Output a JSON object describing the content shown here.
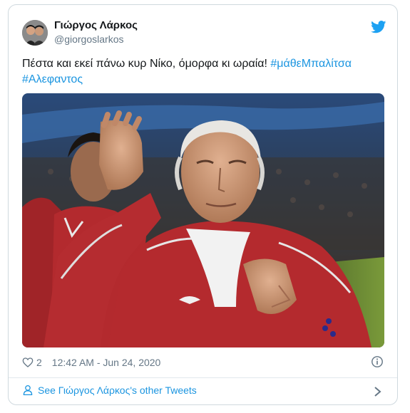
{
  "author": {
    "name": "Γιώργος Λάρκος",
    "handle": "@giorgoslarkos"
  },
  "tweet": {
    "text": "Πέστα και εκεί πάνω κυρ Νίκο, όμορφα κι ωραία! ",
    "hashtags": [
      "#μάθεΜπαλίτσα",
      "#Αλεφαντος"
    ]
  },
  "meta": {
    "likes": "2",
    "timestamp": "12:42 AM - Jun 24, 2020"
  },
  "footer": {
    "label": "See Γιώργος Λάρκος's other Tweets"
  },
  "icons": {
    "bird": "twitter-bird-icon",
    "heart": "heart-icon",
    "info": "info-icon",
    "user": "user-icon",
    "chevron": "chevron-right-icon"
  },
  "colors": {
    "link": "#1b95e0",
    "text": "#14171a",
    "muted": "#657786",
    "border": "#cfd9de"
  }
}
